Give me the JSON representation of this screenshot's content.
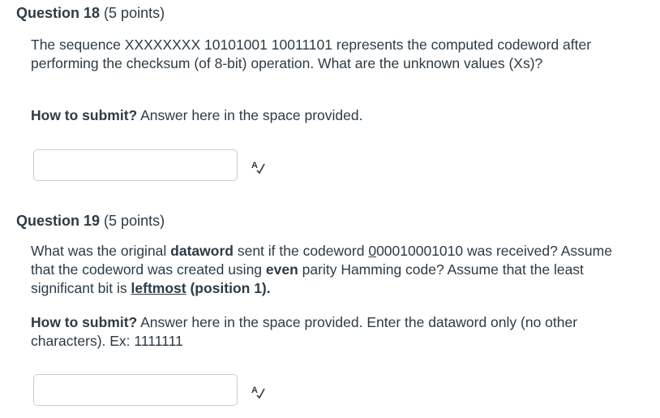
{
  "q18": {
    "title": "Question 18",
    "points": "(5 points)",
    "body": "The sequence XXXXXXXX 10101001 10011101 represents the computed codeword after performing the checksum (of 8-bit) operation. What are the unknown values (Xs)?",
    "submit_label": "How to submit?",
    "submit_text": " Answer here in the space provided.",
    "answer_value": ""
  },
  "q19": {
    "title": "Question 19",
    "points": "(5 points)",
    "body_1": "What was the original ",
    "body_bold_1": "dataword",
    "body_2": " sent if the codeword ",
    "codeword_first": "0",
    "codeword_rest": "00010001010",
    "body_3": " was received? Assume that the codeword was created using ",
    "body_bold_2": "even",
    "body_4": " parity Hamming code? Assume that the least significant bit is ",
    "body_bold_3": "leftmost",
    "body_bold_4": " (position 1).",
    "submit_label": "How to submit?",
    "submit_text": " Answer here in the space provided.  Enter the dataword only (no other characters). Ex: 1111111",
    "answer_value": ""
  },
  "icons": {
    "spellcheck": "spellcheck-icon"
  }
}
